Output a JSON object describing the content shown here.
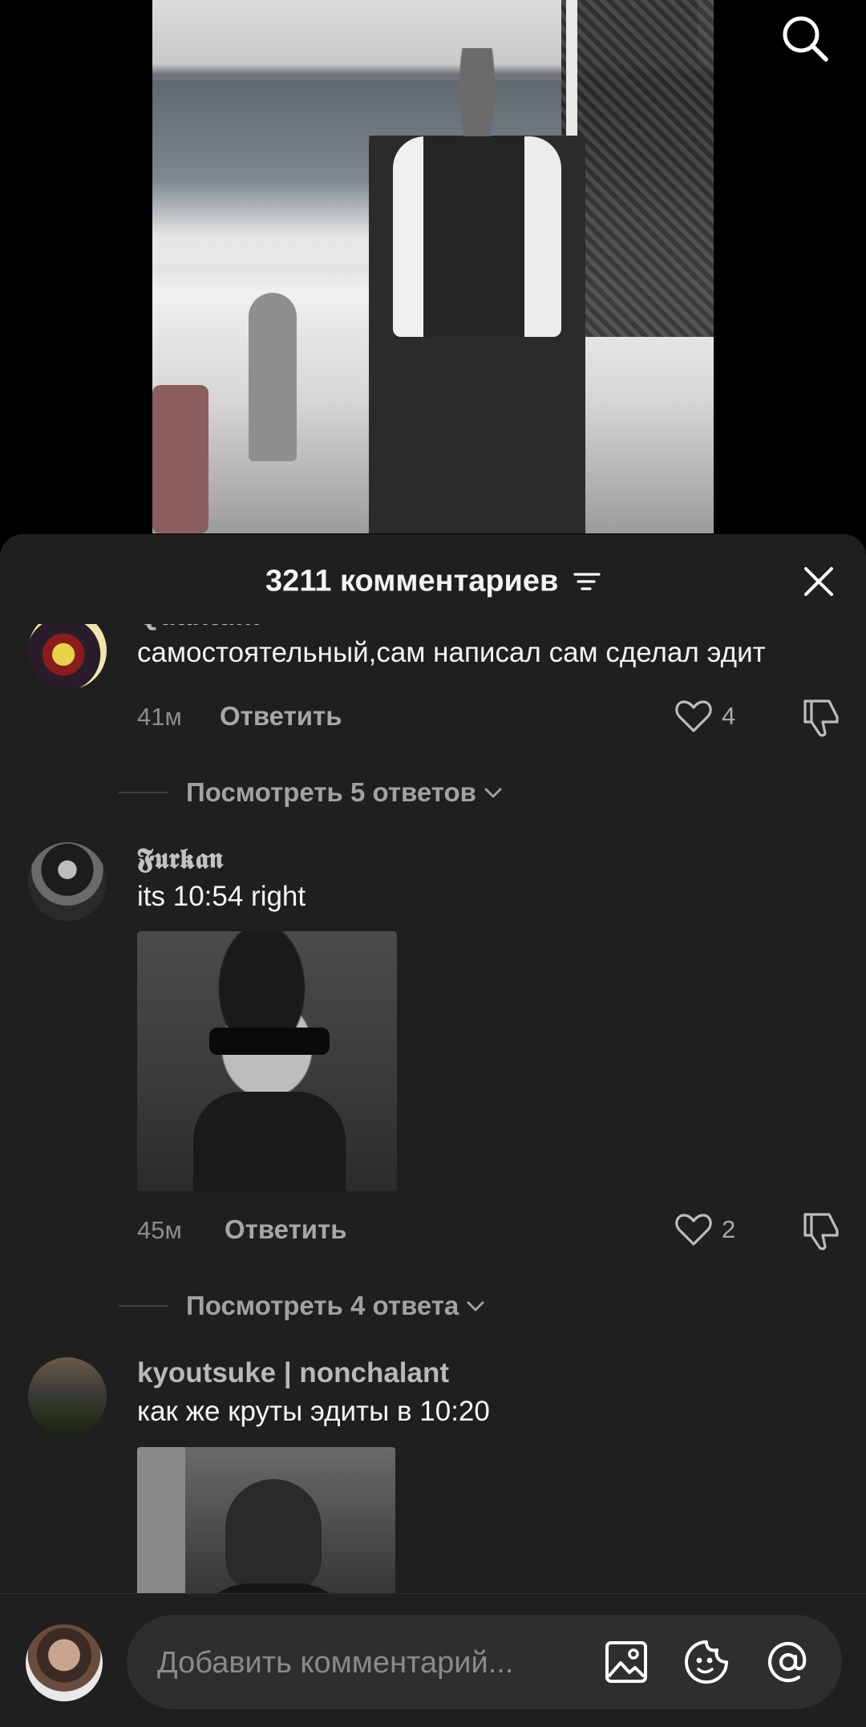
{
  "comments_sheet": {
    "title": "3211 комментариев",
    "comments": [
      {
        "author": "Quantum",
        "text": "самостоятельный,сам написал сам сделал эдит",
        "time": "41м",
        "reply_label": "Ответить",
        "likes": "4",
        "view_replies": "Посмотреть 5 ответов"
      },
      {
        "author": "𝕱𝖚𝖗𝖐𝖆𝖓",
        "text": "its 10:54 right",
        "time": "45м",
        "reply_label": "Ответить",
        "likes": "2",
        "view_replies": "Посмотреть 4 ответа"
      },
      {
        "author": "kyoutsuke | nonchalant",
        "text": "как же круты эдиты в 10:20"
      }
    ]
  },
  "input": {
    "placeholder": "Добавить комментарий..."
  },
  "icons": {
    "top_right": "search-icon",
    "header": [
      "filter-icon",
      "close-icon"
    ],
    "comment_actions": [
      "heart-icon",
      "dislike-icon"
    ],
    "input_bar": [
      "image-icon",
      "emoji-icon",
      "mention-icon"
    ]
  },
  "colors": {
    "sheet_background": "#1f1f1f",
    "input_pill": "#2e2e2e",
    "primary_text": "#f4f4f4",
    "secondary_text": "#a2a2a2"
  }
}
